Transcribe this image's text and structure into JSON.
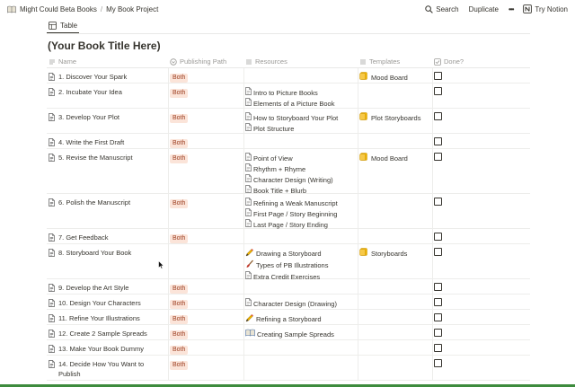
{
  "breadcrumb": {
    "workspace": "Might Could Beta Books",
    "separator": "/",
    "page": "My Book Project"
  },
  "actions": {
    "search": "Search",
    "duplicate": "Duplicate",
    "more": "•••",
    "try": "Try Notion"
  },
  "view_tab": {
    "label": "Table"
  },
  "page_title": "(Your Book Title Here)",
  "columns": {
    "name": "Name",
    "path": "Publishing Path",
    "resources": "Resources",
    "templates": "Templates",
    "done": "Done?"
  },
  "rows": [
    {
      "name": "1. Discover Your Spark",
      "path": "Both",
      "resources": [],
      "templates": [
        {
          "text": "Mood Board",
          "icon": "folder-icon"
        }
      ],
      "done": false
    },
    {
      "name": "2. Incubate Your Idea",
      "path": "Both",
      "resources": [
        {
          "text": "Intro to Picture Books",
          "icon": "doc-icon"
        },
        {
          "text": "Elements of a Picture Book",
          "icon": "doc-icon"
        }
      ],
      "templates": [],
      "done": false
    },
    {
      "name": "3. Develop Your Plot",
      "path": "Both",
      "resources": [
        {
          "text": "How to Storyboard Your Plot",
          "icon": "doc-icon"
        },
        {
          "text": "Plot Structure",
          "icon": "doc-icon"
        }
      ],
      "templates": [
        {
          "text": "Plot Storyboards",
          "icon": "folder-icon"
        }
      ],
      "done": false
    },
    {
      "name": "4. Write the First Draft",
      "path": "Both",
      "resources": [],
      "templates": [],
      "done": false
    },
    {
      "name": "5. Revise the Manuscript",
      "path": "Both",
      "resources": [
        {
          "text": "Point of View",
          "icon": "doc-icon"
        },
        {
          "text": "Rhythm + Rhyme",
          "icon": "doc-icon"
        },
        {
          "text": "Character Design (Writing)",
          "icon": "doc-icon"
        },
        {
          "text": "Book Title + Blurb",
          "icon": "doc-icon"
        }
      ],
      "templates": [
        {
          "text": "Mood Board",
          "icon": "folder-icon"
        }
      ],
      "done": false
    },
    {
      "name": "6. Polish the Manuscript",
      "path": "Both",
      "resources": [
        {
          "text": "Refining a Weak Manuscript",
          "icon": "doc-icon"
        },
        {
          "text": "First Page / Story Beginning",
          "icon": "doc-icon"
        },
        {
          "text": "Last Page / Story Ending",
          "icon": "doc-icon"
        }
      ],
      "templates": [],
      "done": false
    },
    {
      "name": "7. Get Feedback",
      "path": "Both",
      "resources": [],
      "templates": [],
      "done": false
    },
    {
      "name": "8. Storyboard Your Book",
      "path": "",
      "resources": [
        {
          "text": "Drawing a Storyboard",
          "icon": "pencil-icon"
        },
        {
          "text": "Types of PB Illustrations",
          "icon": "brush-icon"
        },
        {
          "text": "Extra Credit Exercises",
          "icon": "doc-icon"
        }
      ],
      "templates": [
        {
          "text": "Storyboards",
          "icon": "folder-icon"
        }
      ],
      "done": false
    },
    {
      "name": "9. Develop the Art Style",
      "path": "Both",
      "resources": [],
      "templates": [],
      "done": false
    },
    {
      "name": "10. Design Your Characters",
      "path": "Both",
      "resources": [
        {
          "text": "Character Design (Drawing)",
          "icon": "doc-icon"
        }
      ],
      "templates": [],
      "done": false
    },
    {
      "name": "11. Refine Your Illustrations",
      "path": "Both",
      "resources": [
        {
          "text": "Refining a Storyboard",
          "icon": "pencil-icon"
        }
      ],
      "templates": [],
      "done": false
    },
    {
      "name": "12. Create 2 Sample Spreads",
      "path": "Both",
      "resources": [
        {
          "text": "Creating Sample Spreads",
          "icon": "book-icon"
        }
      ],
      "templates": [],
      "done": false
    },
    {
      "name": "13. Make Your Book Dummy",
      "path": "Both",
      "resources": [],
      "templates": [],
      "done": false
    },
    {
      "name": "14. Decide How You Want to Publish",
      "path": "Both",
      "resources": [],
      "templates": [],
      "done": false
    }
  ]
}
